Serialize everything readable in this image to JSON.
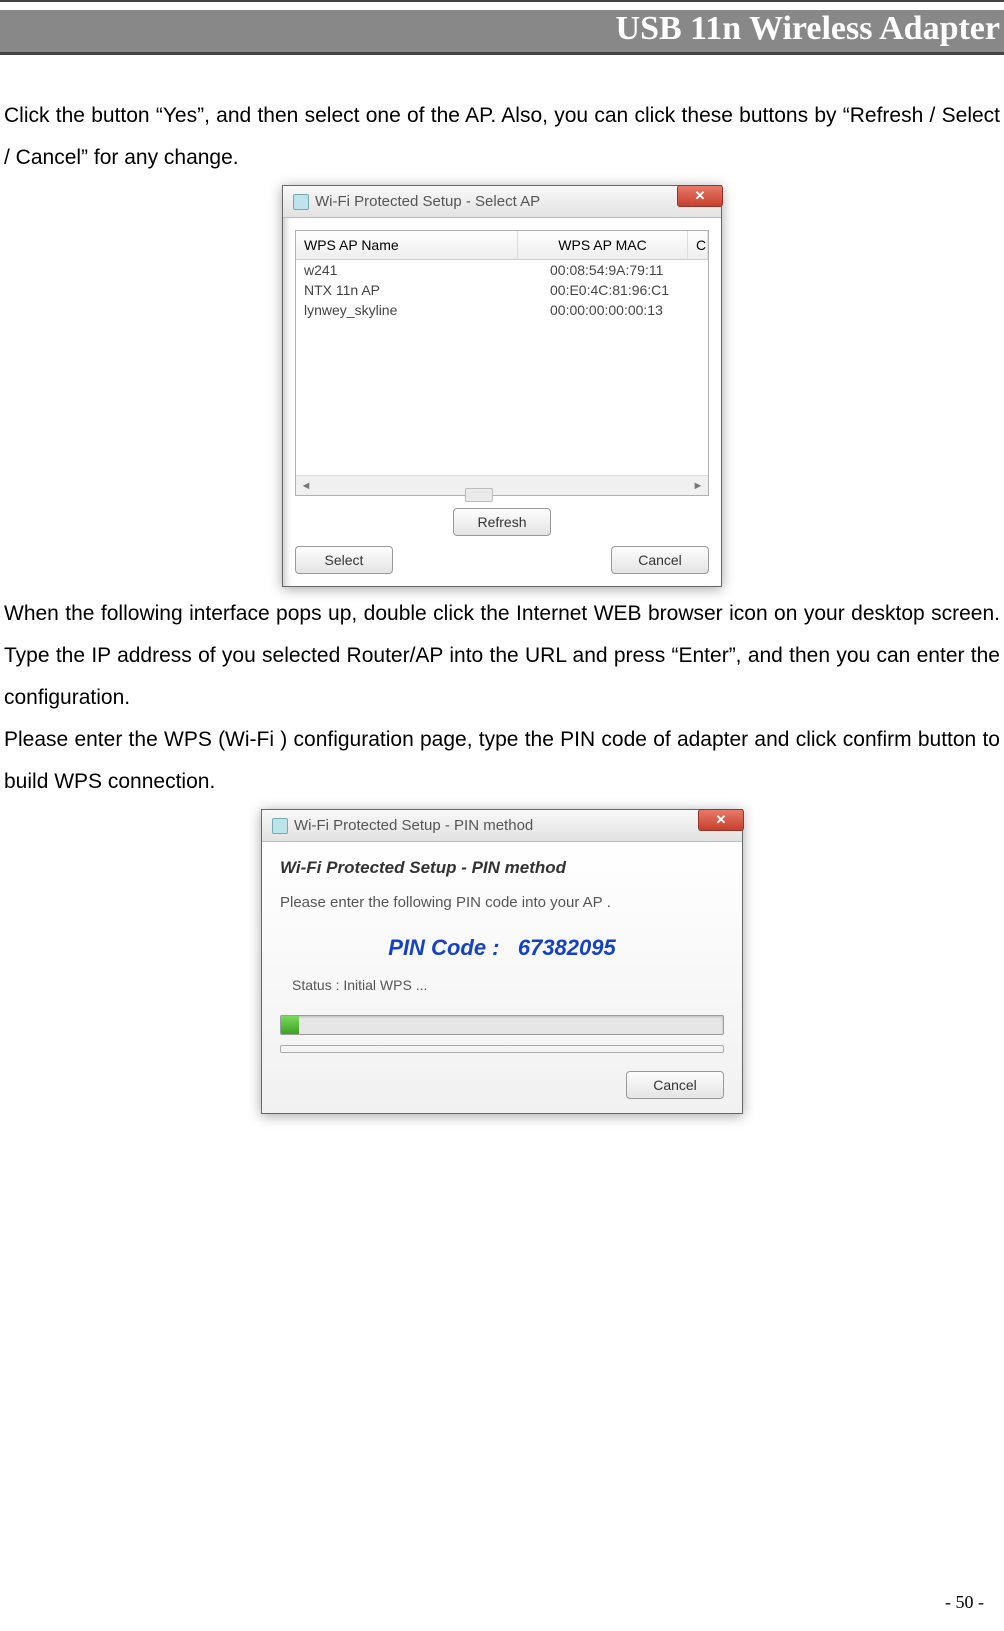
{
  "header": {
    "title": "USB 11n Wireless Adapter"
  },
  "paragraphs": {
    "p1": "Click the button “Yes”, and then select one of the AP. Also, you can click these buttons by “Refresh / Select / Cancel” for any change.",
    "p2": "When the following interface pops up, double click the Internet WEB browser icon on your desktop screen. Type the IP address of you selected Router/AP into the URL and press “Enter”, and then you can enter the configuration.",
    "p3": "Please enter the WPS (Wi-Fi ) configuration page, type the PIN code of adapter and click confirm button to build WPS connection."
  },
  "dialog1": {
    "title": "Wi-Fi Protected Setup - Select AP",
    "columns": {
      "name": "WPS AP Name",
      "mac": "WPS AP MAC",
      "c": "C"
    },
    "rows": [
      {
        "name": "w241",
        "mac": "00:08:54:9A:79:11"
      },
      {
        "name": "NTX 11n AP",
        "mac": "00:E0:4C:81:96:C1"
      },
      {
        "name": "lynwey_skyline",
        "mac": "00:00:00:00:00:13"
      }
    ],
    "buttons": {
      "refresh": "Refresh",
      "select": "Select",
      "cancel": "Cancel"
    }
  },
  "dialog2": {
    "title": "Wi-Fi Protected Setup - PIN method",
    "heading": "Wi-Fi Protected Setup - PIN method",
    "instruction": "Please enter the following PIN code into your AP .",
    "pin_label": "PIN Code :",
    "pin_value": "67382095",
    "status": "Status : Initial WPS ...",
    "buttons": {
      "cancel": "Cancel"
    }
  },
  "page_number": "- 50 -"
}
